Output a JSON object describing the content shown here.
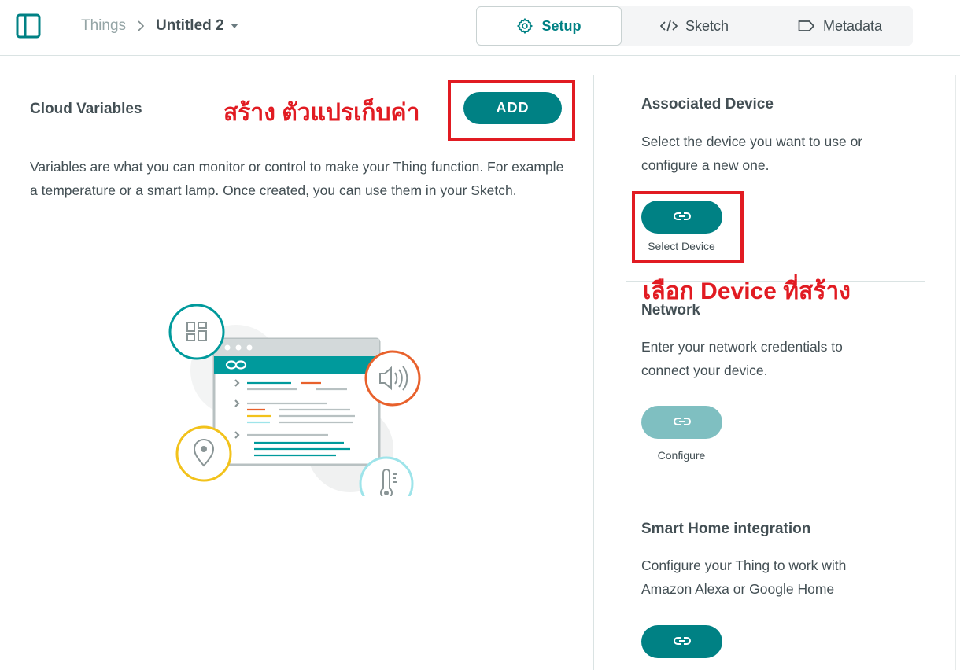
{
  "header": {
    "breadcrumb": {
      "root": "Things",
      "current": "Untitled 2"
    },
    "tabs": [
      {
        "label": "Setup",
        "icon": "gear-icon",
        "active": true
      },
      {
        "label": "Sketch",
        "icon": "code-icon",
        "active": false
      },
      {
        "label": "Metadata",
        "icon": "tag-icon",
        "active": false
      }
    ]
  },
  "cloud_variables": {
    "title": "Cloud Variables",
    "add_label": "ADD",
    "description": "Variables are what you can monitor or control to make your Thing function. For example a temperature or a smart lamp. Once created, you can use them in your Sketch.",
    "illustration_icons": [
      "dashboard-icon",
      "speaker-icon",
      "location-pin-icon",
      "thermometer-icon",
      "arduino-infinity-icon"
    ]
  },
  "annotations": {
    "add_note": "สร้าง ตัวแปรเก็บค่า",
    "device_note": "เลือก Device ที่สร้าง",
    "highlight_color": "#e11b22"
  },
  "associated_device": {
    "title": "Associated Device",
    "description": "Select the device you want to use or configure a new one.",
    "button_caption": "Select Device",
    "button_icon": "link-icon"
  },
  "network": {
    "title": "Network",
    "description": "Enter your network credentials to connect your device.",
    "button_caption": "Configure",
    "button_icon": "link-icon",
    "enabled": false
  },
  "smart_home": {
    "title": "Smart Home integration",
    "description": "Configure your Thing to work with Amazon Alexa or Google Home",
    "button_icon": "link-icon"
  },
  "colors": {
    "accent": "#008184",
    "accent_disabled": "#7fbfc1",
    "text": "#434f54",
    "muted": "#95a5a6"
  }
}
